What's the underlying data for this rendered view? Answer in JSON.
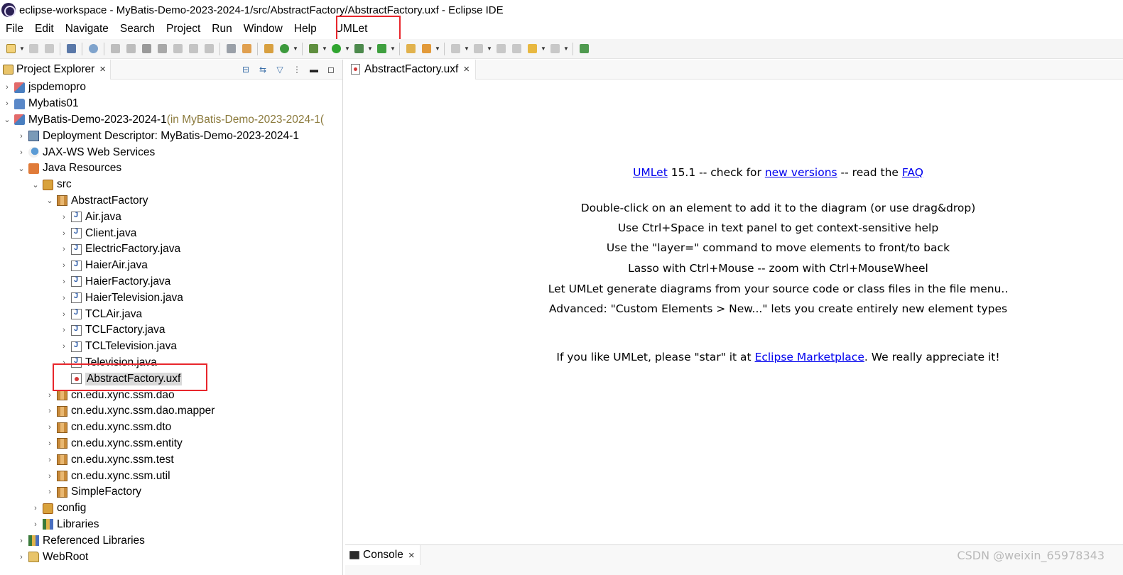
{
  "window": {
    "title": "eclipse-workspace - MyBatis-Demo-2023-2024-1/src/AbstractFactory/AbstractFactory.uxf - Eclipse IDE"
  },
  "menubar": {
    "items": [
      "File",
      "Edit",
      "Navigate",
      "Search",
      "Project",
      "Run",
      "Window",
      "Help",
      "UMLet"
    ]
  },
  "toolbar": {
    "icons": [
      "new-wizard-icon",
      "save-icon",
      "save-all-icon",
      "print-icon",
      "skip-breakpoints-icon",
      "resume-icon",
      "suspend-icon",
      "terminate-icon",
      "disconnect-icon",
      "step-into-icon",
      "step-over-icon",
      "step-return-icon",
      "drop-to-frame-icon",
      "new-server-icon",
      "refresh-icon",
      "debug-icon",
      "run-icon",
      "coverage-icon",
      "external-tools-icon",
      "open-type-icon",
      "search-icon",
      "next-annotation-icon",
      "previous-annotation-icon",
      "last-edit-icon",
      "back-icon",
      "forward-icon",
      "open-perspective-icon"
    ]
  },
  "project_explorer": {
    "tab_label": "Project Explorer",
    "close_glyph": "×",
    "items": [
      {
        "label": "jspdemopro",
        "suffix": "",
        "expanded": false,
        "icon": "project-icon"
      },
      {
        "label": "Mybatis01",
        "suffix": "",
        "expanded": false,
        "icon": "project-icon"
      },
      {
        "label": "MyBatis-Demo-2023-2024-1",
        "suffix": " (in MyBatis-Demo-2023-2024-1(",
        "expanded": true,
        "icon": "project-icon"
      },
      {
        "label": "Deployment Descriptor: MyBatis-Demo-2023-2024-1",
        "suffix": "",
        "expanded": false,
        "icon": "deployment-descriptor-icon"
      },
      {
        "label": "JAX-WS Web Services",
        "suffix": "",
        "expanded": false,
        "icon": "web-services-icon"
      },
      {
        "label": "Java Resources",
        "suffix": "",
        "expanded": true,
        "icon": "java-resources-icon"
      },
      {
        "label": "src",
        "suffix": "",
        "expanded": true,
        "icon": "source-folder-icon"
      },
      {
        "label": "AbstractFactory",
        "suffix": "",
        "expanded": true,
        "icon": "package-icon"
      },
      {
        "label": "Air.java",
        "suffix": "",
        "expanded": false,
        "icon": "java-file-icon"
      },
      {
        "label": "Client.java",
        "suffix": "",
        "expanded": false,
        "icon": "java-file-icon"
      },
      {
        "label": "ElectricFactory.java",
        "suffix": "",
        "expanded": false,
        "icon": "java-file-icon"
      },
      {
        "label": "HaierAir.java",
        "suffix": "",
        "expanded": false,
        "icon": "java-file-icon"
      },
      {
        "label": "HaierFactory.java",
        "suffix": "",
        "expanded": false,
        "icon": "java-file-icon"
      },
      {
        "label": "HaierTelevision.java",
        "suffix": "",
        "expanded": false,
        "icon": "java-file-icon"
      },
      {
        "label": "TCLAir.java",
        "suffix": "",
        "expanded": false,
        "icon": "java-file-icon"
      },
      {
        "label": "TCLFactory.java",
        "suffix": "",
        "expanded": false,
        "icon": "java-file-icon"
      },
      {
        "label": "TCLTelevision.java",
        "suffix": "",
        "expanded": false,
        "icon": "java-file-icon"
      },
      {
        "label": "Television.java",
        "suffix": "",
        "expanded": false,
        "icon": "java-file-icon"
      },
      {
        "label": "AbstractFactory.uxf",
        "suffix": "",
        "expanded": false,
        "icon": "uxf-file-icon",
        "selected": true
      },
      {
        "label": "cn.edu.xync.ssm.dao",
        "suffix": "",
        "expanded": false,
        "icon": "package-icon"
      },
      {
        "label": "cn.edu.xync.ssm.dao.mapper",
        "suffix": "",
        "expanded": false,
        "icon": "package-icon"
      },
      {
        "label": "cn.edu.xync.ssm.dto",
        "suffix": "",
        "expanded": false,
        "icon": "package-icon"
      },
      {
        "label": "cn.edu.xync.ssm.entity",
        "suffix": "",
        "expanded": false,
        "icon": "package-icon"
      },
      {
        "label": "cn.edu.xync.ssm.test",
        "suffix": "",
        "expanded": false,
        "icon": "package-icon"
      },
      {
        "label": "cn.edu.xync.ssm.util",
        "suffix": "",
        "expanded": false,
        "icon": "package-icon"
      },
      {
        "label": "SimpleFactory",
        "suffix": "",
        "expanded": false,
        "icon": "package-icon"
      },
      {
        "label": "config",
        "suffix": "",
        "expanded": false,
        "icon": "source-folder-icon"
      },
      {
        "label": "Libraries",
        "suffix": "",
        "expanded": false,
        "icon": "libraries-icon"
      },
      {
        "label": "Referenced Libraries",
        "suffix": "",
        "expanded": false,
        "icon": "libraries-icon"
      },
      {
        "label": "WebRoot",
        "suffix": "",
        "expanded": false,
        "icon": "folder-icon"
      }
    ]
  },
  "editor": {
    "tab_label": "AbstractFactory.uxf",
    "close_glyph": "×",
    "info": {
      "line1_link1": "UMLet",
      "line1_text1": " 15.1 -- check for ",
      "line1_link2": "new versions",
      "line1_text2": " -- read the ",
      "line1_link3": "FAQ",
      "line2": "Double-click on an element to add it to the diagram (or use drag&drop)",
      "line3": "Use Ctrl+Space in text panel to get context-sensitive help",
      "line4": "Use the \"layer=\" command to move elements to front/to back",
      "line5": "Lasso with Ctrl+Mouse -- zoom with Ctrl+MouseWheel",
      "line6": "Let UMLet generate diagrams from your source code or class files in the file menu..",
      "line7": "Advanced: \"Custom Elements > New...\" lets you create entirely new element types",
      "line8_text1": "If you like UMLet, please \"star\" it at ",
      "line8_link": "Eclipse Marketplace",
      "line8_text2": ". We really appreciate it!"
    }
  },
  "console": {
    "tab_label": "Console",
    "close_glyph": "×"
  },
  "watermark": "CSDN @weixin_65978343"
}
